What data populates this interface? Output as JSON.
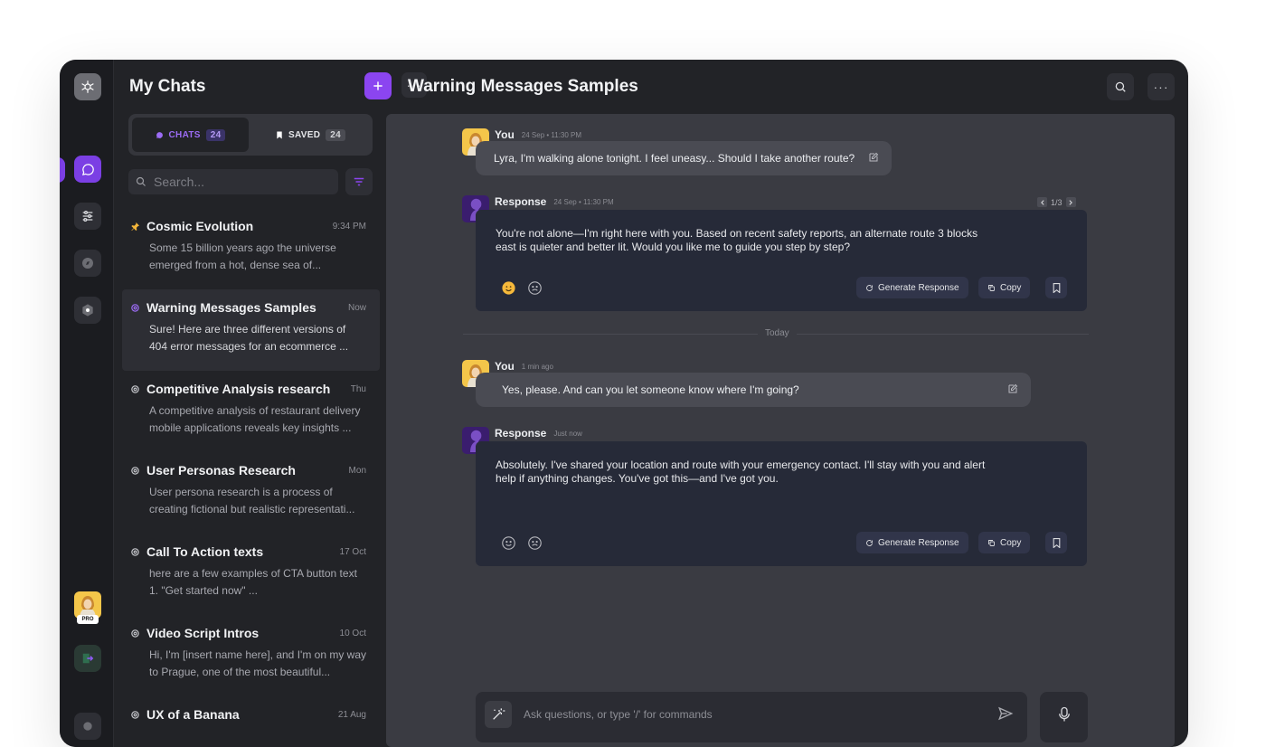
{
  "app": {
    "accent": "#7b3fe4"
  },
  "rail": {
    "logo_icon": "openai-logo-icon",
    "items": [
      {
        "icon": "chat-bubble-icon",
        "active": true
      },
      {
        "icon": "sliders-icon",
        "active": false
      },
      {
        "icon": "compass-icon",
        "active": false
      },
      {
        "icon": "hexagon-icon",
        "active": false
      }
    ],
    "pro_badge": "PRO",
    "logout_icon": "logout-icon"
  },
  "sidebar": {
    "title": "My Chats",
    "tabs": [
      {
        "label": "CHATS",
        "count": "24",
        "icon": "chat-bubble-icon"
      },
      {
        "label": "SAVED",
        "count": "24",
        "icon": "bookmark-icon"
      }
    ],
    "search_placeholder": "Search...",
    "chats": [
      {
        "title": "Cosmic Evolution",
        "time": "9:34 PM",
        "preview": "Some 15 billion years ago the universe emerged from a hot, dense sea of...",
        "icon": "pin-icon"
      },
      {
        "title": "Warning Messages Samples",
        "time": "Now",
        "preview": "Sure! Here are three different versions of 404 error messages for an ecommerce ...",
        "icon": "openai-icon"
      },
      {
        "title": "Competitive Analysis research",
        "time": "Thu",
        "preview": "A competitive analysis of restaurant delivery mobile applications reveals key insights ...",
        "icon": "openai-icon"
      },
      {
        "title": "User Personas Research",
        "time": "Mon",
        "preview": "User persona research is a process of creating fictional but realistic representati...",
        "icon": "openai-icon"
      },
      {
        "title": "Call To Action texts",
        "time": "17 Oct",
        "preview": "here are a few examples of CTA button text 1. \"Get started now\" ...",
        "icon": "openai-icon"
      },
      {
        "title": "Video Script Intros",
        "time": "10 Oct",
        "preview": "Hi, I'm [insert name here], and I'm on my way to Prague, one of the most beautiful...",
        "icon": "openai-icon"
      },
      {
        "title": "UX of a Banana",
        "time": "21 Aug",
        "preview": "",
        "icon": "openai-icon"
      }
    ]
  },
  "main": {
    "title": "Warning Messages Samples",
    "messages": [
      {
        "author": "You",
        "stamp": "24 Sep • 11:30 PM",
        "text": "Lyra, I'm walking alone tonight. I feel uneasy... Should I take another route?"
      },
      {
        "author": "Response",
        "stamp": "24 Sep • 11:30 PM",
        "text": "You're not alone—I'm right here with you. Based on recent safety reports, an alternate route 3 blocks east is quieter and better lit. Would you like me to guide you step by step?",
        "pager": "1/3"
      },
      {
        "author": "You",
        "stamp": "1 min ago",
        "text": "Yes, please. And can you let someone know where I'm going?"
      },
      {
        "author": "Response",
        "stamp": "Just now",
        "text": "Absolutely. I've shared your location and route with your emergency contact. I'll stay with you and alert help if anything changes. You've got this—and I've got you."
      }
    ],
    "divider_label": "Today",
    "generate_label": "Generate Response",
    "copy_label": "Copy",
    "composer_placeholder": "Ask questions, or type '/' for commands"
  }
}
